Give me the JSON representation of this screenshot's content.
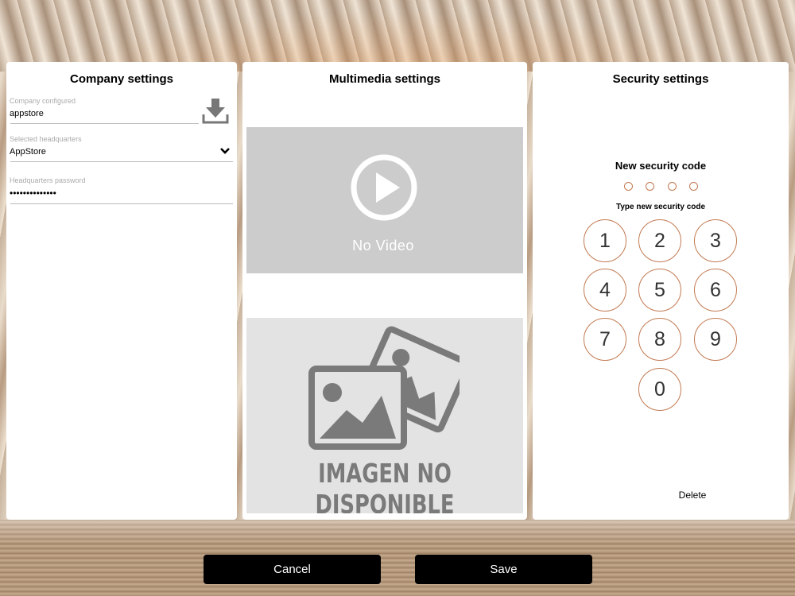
{
  "company": {
    "title": "Company settings",
    "company_label": "Company configured",
    "company_value": "appstore",
    "hq_label": "Selected headquarters",
    "hq_value": "AppStore",
    "password_label": "Headquarters password",
    "password_value": "••••••••••••••"
  },
  "multimedia": {
    "title": "Multimedia settings",
    "no_video": "No Video",
    "no_image": "IMAGEN NO DISPONIBLE"
  },
  "security": {
    "title": "Security settings",
    "subtitle": "New security code",
    "hint": "Type new security code",
    "keys": [
      "1",
      "2",
      "3",
      "4",
      "5",
      "6",
      "7",
      "8",
      "9",
      "0"
    ],
    "delete_label": "Delete",
    "accent_color": "#c27a52"
  },
  "actions": {
    "cancel_label": "Cancel",
    "save_label": "Save"
  },
  "icons": {
    "download": "download-icon",
    "chevron": "chevron-down-icon",
    "play": "play-icon",
    "image_placeholder": "image-placeholder-icon"
  }
}
